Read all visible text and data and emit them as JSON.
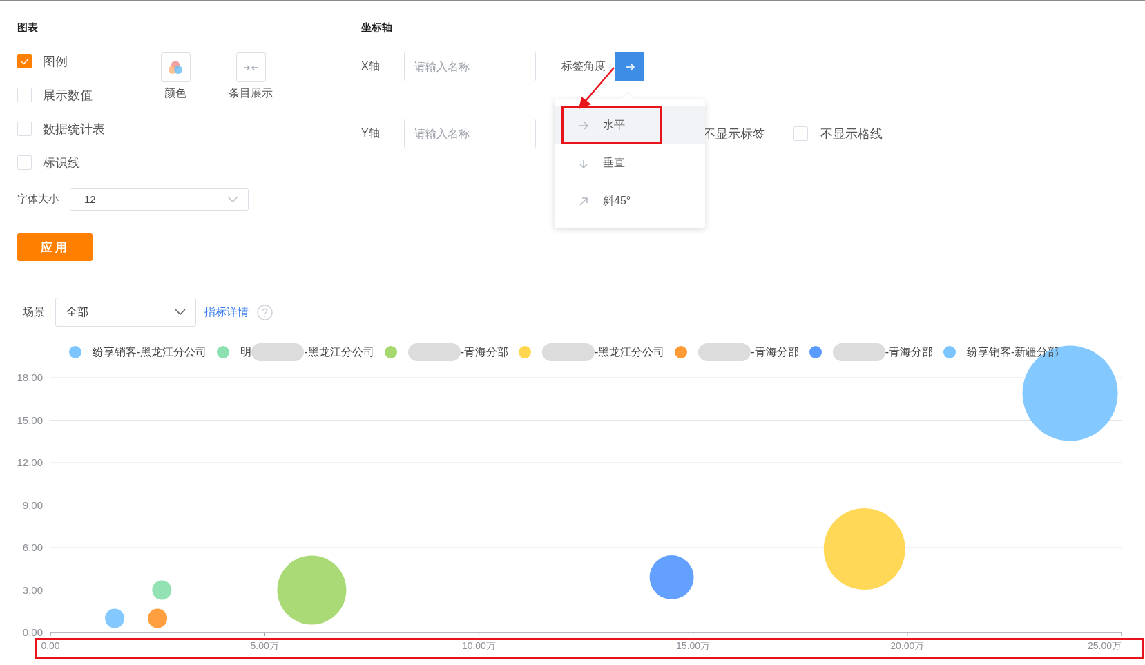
{
  "chart_settings": {
    "title": "图表",
    "options": [
      {
        "label": "图例",
        "checked": true
      },
      {
        "label": "展示数值",
        "checked": false
      },
      {
        "label": "数据统计表",
        "checked": false
      },
      {
        "label": "标识线",
        "checked": false
      }
    ],
    "tools": [
      {
        "label": "颜色",
        "kind": "color"
      },
      {
        "label": "条目展示",
        "kind": "compact"
      }
    ],
    "font_size": {
      "label": "字体大小",
      "value": "12"
    },
    "apply_button": "应用"
  },
  "axes": {
    "title": "坐标轴",
    "x_axis": {
      "label": "X轴",
      "placeholder": "请输入名称"
    },
    "label_angle": {
      "label": "标签角度"
    },
    "y_axis": {
      "label": "Y轴",
      "placeholder": "请输入名称"
    },
    "hide_labels": {
      "label": "不显示标签"
    },
    "hide_grid": {
      "label": "不显示格线",
      "checked": false
    }
  },
  "angle_menu": {
    "options": [
      {
        "label": "水平",
        "kind": "horizontal",
        "selected": true
      },
      {
        "label": "垂直",
        "kind": "vertical",
        "selected": false
      },
      {
        "label": "斜45°",
        "kind": "diagonal",
        "selected": false
      }
    ]
  },
  "annotations": [
    {
      "kind": "arrow"
    },
    {
      "kind": "option_box"
    },
    {
      "kind": "axis_box"
    }
  ],
  "filter": {
    "label": "场景",
    "value": "全部",
    "link": "指标详情"
  },
  "legend": [
    {
      "redacted": false,
      "text": "纷享销客-黑龙江分公司",
      "color": "#7cc5ff"
    },
    {
      "redacted": true,
      "before": "明",
      "after": "-黑龙江分公司",
      "color": "#8de0b0"
    },
    {
      "redacted": true,
      "after": "-青海分部",
      "color": "#a5d86e"
    },
    {
      "redacted": true,
      "after": "-黑龙江分公司",
      "color": "#ffd64f"
    },
    {
      "redacted": true,
      "after": "-青海分部",
      "color": "#ff9a35"
    },
    {
      "redacted": true,
      "after": "-青海分部",
      "color": "#5b9bff"
    },
    {
      "redacted": false,
      "text": "纷享销客-新疆分部",
      "color": "#7cc5ff"
    }
  ],
  "chart_data": {
    "type": "scatter",
    "grid": true,
    "xlim": [
      0,
      25
    ],
    "ylim": [
      0,
      18
    ],
    "xticks": [
      {
        "value": 0,
        "label": "0.00"
      },
      {
        "value": 5,
        "label": "5.00万"
      },
      {
        "value": 10,
        "label": "10.00万"
      },
      {
        "value": 15,
        "label": "15.00万"
      },
      {
        "value": 20,
        "label": "20.00万"
      },
      {
        "value": 25,
        "label": "25.00万"
      }
    ],
    "yticks": [
      {
        "value": 0,
        "label": "0.00"
      },
      {
        "value": 3,
        "label": "3.00"
      },
      {
        "value": 6,
        "label": "6.00"
      },
      {
        "value": 9,
        "label": "9.00"
      },
      {
        "value": 12,
        "label": "12.00"
      },
      {
        "value": 15,
        "label": "15.00"
      },
      {
        "value": 18,
        "label": "18.00"
      }
    ],
    "series": [
      {
        "color": "#7cc5ff",
        "x": [
          1.5
        ],
        "values": [
          1
        ]
      },
      {
        "color": "#8de0b0",
        "x": [
          2.6
        ],
        "values": [
          3
        ]
      },
      {
        "color": "#a5d86e",
        "x": [
          6.1
        ],
        "values": [
          3
        ]
      },
      {
        "color": "#ffd64f",
        "x": [
          19
        ],
        "values": [
          5.9
        ]
      },
      {
        "color": "#ff9a35",
        "x": [
          2.5
        ],
        "values": [
          1
        ]
      },
      {
        "color": "#5b9bff",
        "x": [
          14.5
        ],
        "values": [
          3.9
        ]
      },
      {
        "color": "#7cc5ff",
        "x": [
          23.8
        ],
        "values": [
          16.9
        ]
      }
    ]
  }
}
